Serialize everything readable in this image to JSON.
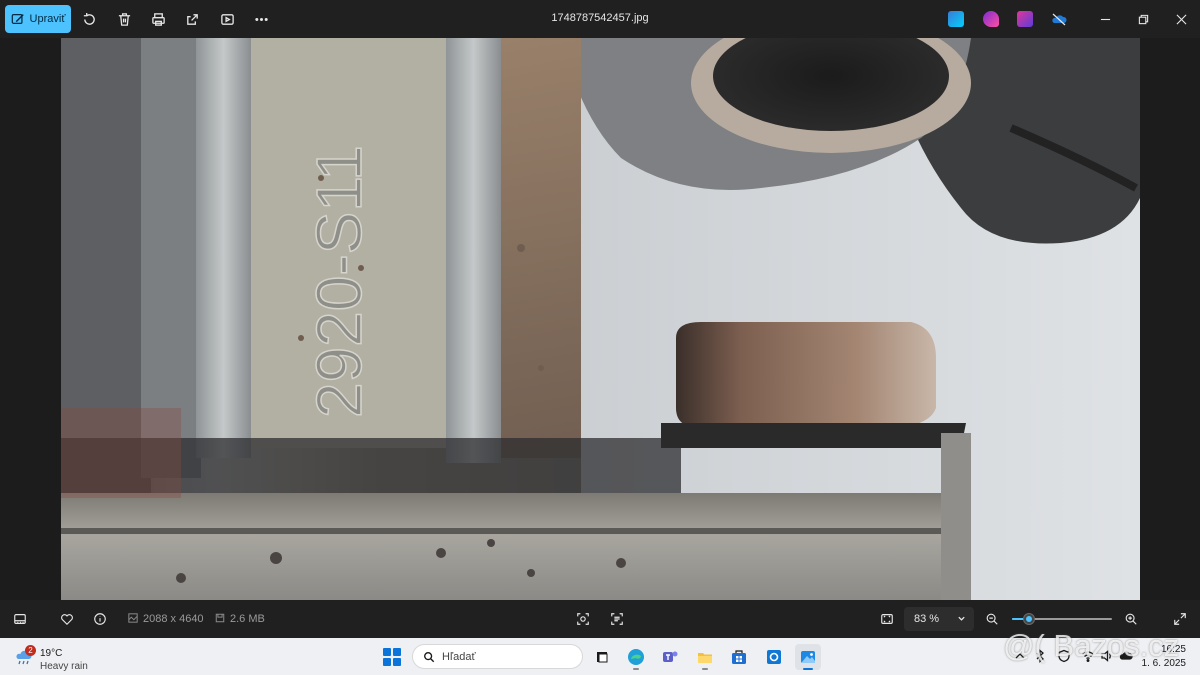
{
  "toolbar": {
    "edit_label": "Upraviť",
    "filename": "1748787542457.jpg",
    "icons": [
      "rotate-icon",
      "delete-icon",
      "print-icon",
      "share-icon",
      "slideshow-icon",
      "more-icon"
    ],
    "app_icons": [
      "designer-icon",
      "clipchamp-icon",
      "photos-editor-icon",
      "onedrive-icon"
    ],
    "window_controls": [
      "minimize-icon",
      "restore-icon",
      "close-icon"
    ]
  },
  "photo": {
    "description_text": "2920-S11"
  },
  "infobar": {
    "dimensions": "2088 x 4640",
    "filesize": "2.6 MB",
    "zoom": "83 %",
    "zoom_level": 0.13
  },
  "taskbar": {
    "weather_temp": "19°C",
    "weather_cond": "Heavy rain",
    "weather_badge": "2",
    "search_placeholder": "Hľadať",
    "time": "16:25",
    "date": "1. 6. 2025",
    "apps": [
      "task-view",
      "edge",
      "teams",
      "file-explorer",
      "store",
      "outlook",
      "photos"
    ]
  },
  "watermark": "@( Bazos.cz",
  "colors": {
    "accent": "#4cc2ff",
    "toolbar_bg": "#202020",
    "taskbar_bg": "#eef0f3"
  }
}
